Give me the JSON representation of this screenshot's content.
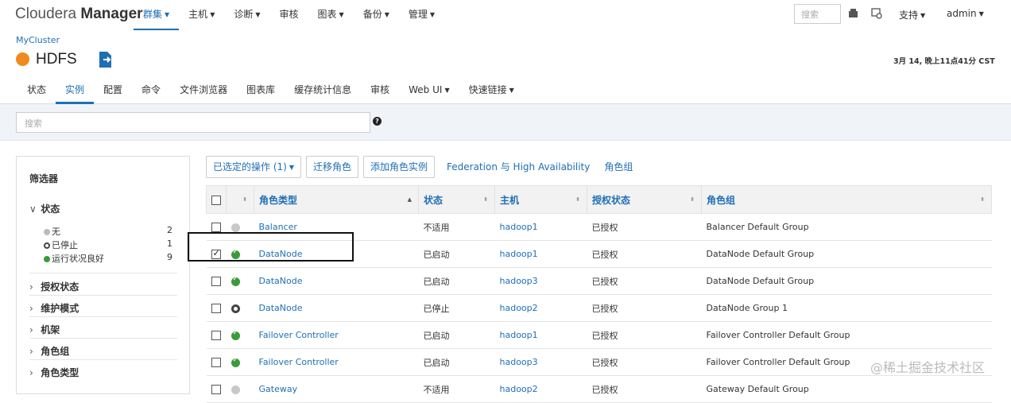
{
  "app": {
    "brand_light": "Cloudera",
    "brand_bold": "Manager"
  },
  "topnav": [
    {
      "label": "群集",
      "dropdown": true,
      "active": true
    },
    {
      "label": "主机",
      "dropdown": true
    },
    {
      "label": "诊断",
      "dropdown": true
    },
    {
      "label": "审核",
      "dropdown": false
    },
    {
      "label": "图表",
      "dropdown": true
    },
    {
      "label": "备份",
      "dropdown": true
    },
    {
      "label": "管理",
      "dropdown": true
    }
  ],
  "topbar": {
    "search_placeholder": "搜索",
    "support_label": "支持",
    "user_label": "admin"
  },
  "breadcrumb": "MyCluster",
  "service": {
    "name": "HDFS",
    "status_color": "#f08a1c",
    "timestamp": "3月 14, 晚上11点41分 CST"
  },
  "subnav": [
    {
      "label": "状态"
    },
    {
      "label": "实例",
      "active": true
    },
    {
      "label": "配置"
    },
    {
      "label": "命令"
    },
    {
      "label": "文件浏览器"
    },
    {
      "label": "图表库"
    },
    {
      "label": "缓存统计信息"
    },
    {
      "label": "审核"
    },
    {
      "label": "Web UI",
      "dropdown": true
    },
    {
      "label": "快速链接",
      "dropdown": true
    }
  ],
  "search": {
    "placeholder": "搜索"
  },
  "filters": {
    "title": "筛选器",
    "status_section": "状态",
    "status_items": [
      {
        "label": "无",
        "count": "2",
        "icon": "none"
      },
      {
        "label": "已停止",
        "count": "1",
        "icon": "stopped"
      },
      {
        "label": "运行状况良好",
        "count": "9",
        "icon": "good"
      }
    ],
    "sections": [
      "授权状态",
      "维护模式",
      "机架",
      "角色组",
      "角色类型"
    ]
  },
  "actions": {
    "selected_ops": "已选定的操作 (1)",
    "migrate": "迁移角色",
    "add_instance": "添加角色实例",
    "federation": "Federation 与 High Availability",
    "role_groups": "角色组"
  },
  "table": {
    "headers": [
      "角色类型",
      "状态",
      "主机",
      "授权状态",
      "角色组"
    ],
    "rows": [
      {
        "checked": false,
        "health": "none",
        "role": "Balancer",
        "state": "不适用",
        "host": "hadoop1",
        "auth": "已授权",
        "group": "Balancer Default Group"
      },
      {
        "checked": true,
        "health": "good",
        "role": "DataNode",
        "state": "已启动",
        "host": "hadoop1",
        "auth": "已授权",
        "group": "DataNode Default Group"
      },
      {
        "checked": false,
        "health": "good",
        "role": "DataNode",
        "state": "已启动",
        "host": "hadoop3",
        "auth": "已授权",
        "group": "DataNode Default Group"
      },
      {
        "checked": false,
        "health": "stopped",
        "role": "DataNode",
        "state": "已停止",
        "host": "hadoop2",
        "auth": "已授权",
        "group": "DataNode Group 1"
      },
      {
        "checked": false,
        "health": "good",
        "role": "Failover Controller",
        "state": "已启动",
        "host": "hadoop1",
        "auth": "已授权",
        "group": "Failover Controller Default Group"
      },
      {
        "checked": false,
        "health": "good",
        "role": "Failover Controller",
        "state": "已启动",
        "host": "hadoop3",
        "auth": "已授权",
        "group": "Failover Controller Default Group"
      },
      {
        "checked": false,
        "health": "none",
        "role": "Gateway",
        "state": "不适用",
        "host": "hadoop2",
        "auth": "已授权",
        "group": "Gateway Default Group"
      }
    ]
  },
  "watermark": "@稀土掘金技术社区"
}
